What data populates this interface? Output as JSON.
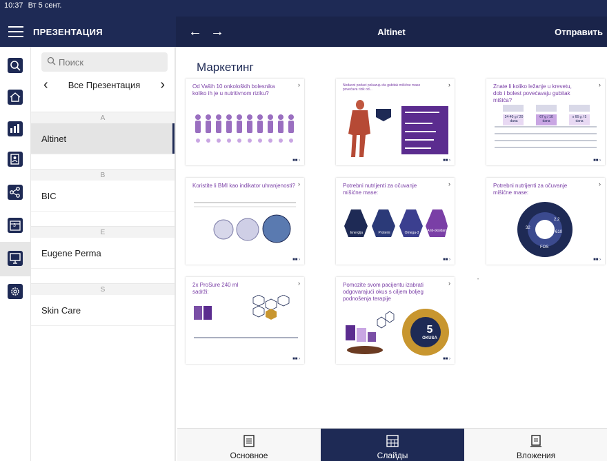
{
  "status": {
    "time": "10:37",
    "date": "Вт 5 сент."
  },
  "left_header": {
    "title": "ПРЕЗЕНТАЦИЯ"
  },
  "right_header": {
    "back": "←",
    "forward": "→",
    "title": "Altinet",
    "send": "Отправить"
  },
  "colors": {
    "navy": "#1e2a55",
    "purple": "#7a3fa6"
  },
  "rail": {
    "icons": [
      "search-icon",
      "home-icon",
      "report-icon",
      "contacts-icon",
      "share-icon",
      "calendar-icon",
      "presentation-icon",
      "settings-icon"
    ],
    "calendar_day": "3"
  },
  "search": {
    "placeholder": "Поиск"
  },
  "filter": {
    "label": "Все Презентация",
    "prev": "‹",
    "next": "›"
  },
  "sections": [
    {
      "letter": "A",
      "items": [
        "Altinet"
      ]
    },
    {
      "letter": "B",
      "items": [
        "BIC"
      ]
    },
    {
      "letter": "E",
      "items": [
        "Eugene Perma"
      ]
    },
    {
      "letter": "S",
      "items": [
        "Skin Care"
      ]
    }
  ],
  "main": {
    "heading": "Маркетинг",
    "slides": [
      {
        "title": "Od Vaših 10 onkoloških bolesnika koliko ih je u nutritivnom riziku?"
      },
      {
        "title": "Nedavni podaci pokazuju da gubitak mišićne mase povećava rizik od..."
      },
      {
        "title": "Znate li koliko ležanje u krevetu, dob i bolest povećavaju gubitak mišića?",
        "values": [
          "24-40 g / 20 dana",
          "67 g / 10 dana",
          "x 66 g / 5 dana"
        ]
      },
      {
        "title": "Koristite li BMI kao indikator uhranjenosti?"
      },
      {
        "title": "Potrebni nutrijenti za očuvanje mišićne mase:",
        "labels": [
          "Energija",
          "Proteini",
          "Omega-3",
          "Anti-oksidansi"
        ]
      },
      {
        "title": "Potrebni nutrijenti za očuvanje mišićne mase:",
        "labels": [
          "32",
          "2,2",
          "610",
          "FOS"
        ]
      },
      {
        "title": "2x ProSure 240 ml sadrži:"
      },
      {
        "title": "Pomozite svom pacijentu izabrati odgovarajući okus s ciljem boljeg podnošenja terapije",
        "badge_number": "5",
        "badge_text": "OKUSA"
      }
    ]
  },
  "tabs": [
    {
      "label": "Основное",
      "icon": "document-icon",
      "active": false
    },
    {
      "label": "Слайды",
      "icon": "slides-grid-icon",
      "active": true
    },
    {
      "label": "Вложения",
      "icon": "attachment-icon",
      "active": false
    }
  ]
}
